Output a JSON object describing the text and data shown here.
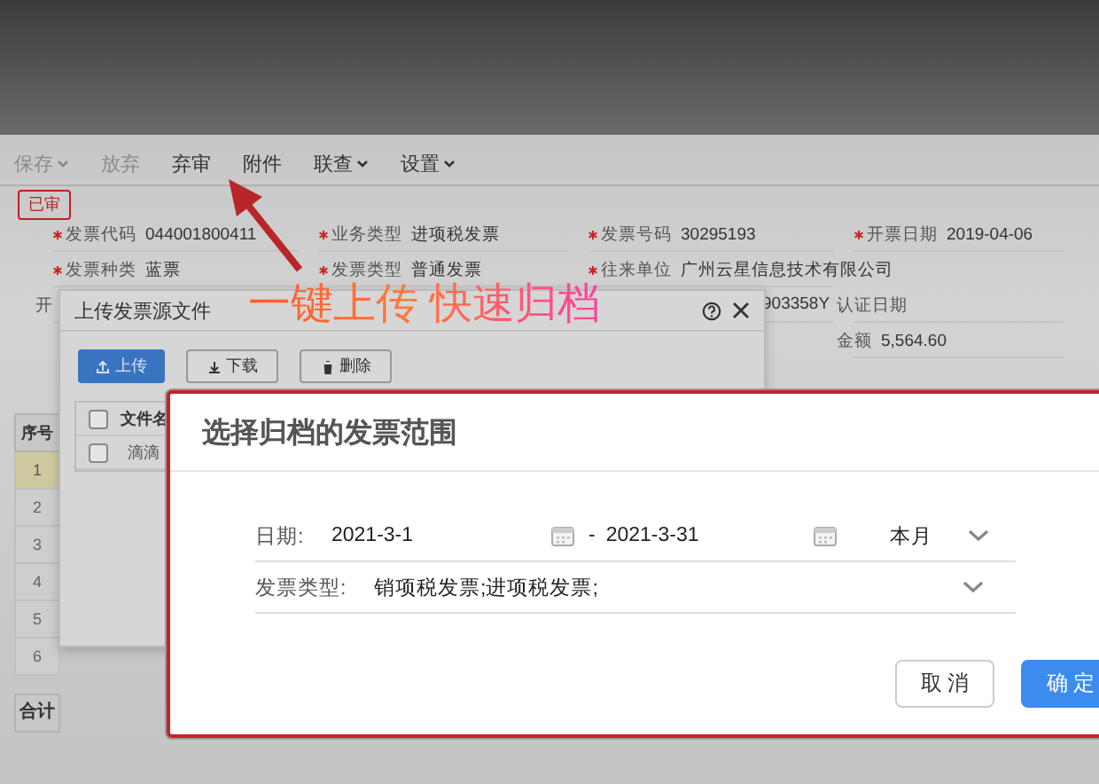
{
  "toolbar": [
    {
      "label": "保存",
      "has_menu": true,
      "disabled": true
    },
    {
      "label": "放弃",
      "has_menu": false,
      "disabled": true
    },
    {
      "label": "弃审",
      "has_menu": false,
      "disabled": false
    },
    {
      "label": "附件",
      "has_menu": false,
      "disabled": false
    },
    {
      "label": "联查",
      "has_menu": true,
      "disabled": false
    },
    {
      "label": "设置",
      "has_menu": true,
      "disabled": false
    }
  ],
  "status_tag": "已审",
  "form_rows": [
    [
      {
        "label": "发票代码",
        "value": "044001800411",
        "required": true
      },
      {
        "label": "业务类型",
        "value": "进项税发票",
        "required": true
      },
      {
        "label": "发票号码",
        "value": "30295193",
        "required": true
      },
      {
        "label": "开票日期",
        "value": "2019-04-06",
        "required": true
      }
    ],
    [
      {
        "label": "发票种类",
        "value": "蓝票",
        "required": true
      },
      {
        "label": "发票类型",
        "value": "普通发票",
        "required": true
      },
      {
        "label": "往来单位",
        "value": "广州云星信息技术有限公司",
        "required": true
      },
      {}
    ],
    [
      {
        "label": "开",
        "required": false
      },
      {},
      {
        "value": "903358Y"
      },
      {
        "label": "认证日期",
        "required": false
      }
    ],
    [
      {},
      {},
      {},
      {
        "label": "金额",
        "value": "5,564.60",
        "required": false
      }
    ]
  ],
  "grid": {
    "header": "序号",
    "rows": [
      {
        "number": "1",
        "selected": true
      },
      {
        "number": "2",
        "selected": false
      },
      {
        "number": "3",
        "selected": false
      },
      {
        "number": "4",
        "selected": false
      },
      {
        "number": "5",
        "selected": false
      },
      {
        "number": "6",
        "selected": false
      }
    ],
    "footer": "合计"
  },
  "upload_dialog": {
    "title": "上传发票源文件",
    "buttons": [
      {
        "label": "上传",
        "kind": "primary"
      },
      {
        "label": "下载",
        "kind": "download"
      },
      {
        "label": "删除",
        "kind": "delete"
      }
    ],
    "table": {
      "header_checked": false,
      "columns": [
        "文件名"
      ],
      "rows": [
        {
          "file": "滴滴",
          "checked": false
        }
      ]
    }
  },
  "annotation": "一键上传 快速归档",
  "archive_dialog": {
    "title": "选择归档的发票范围",
    "date_label": "日期:",
    "date_start": "2021-3-1",
    "separator": "-",
    "date_end": "2021-3-31",
    "period": "本月",
    "type_label": "发票类型:",
    "type_value": "销项税发票;进项税发票;",
    "buttons": [
      {
        "label": "取 消",
        "kind": "secondary"
      },
      {
        "label": "确 定",
        "kind": "primary"
      }
    ]
  }
}
